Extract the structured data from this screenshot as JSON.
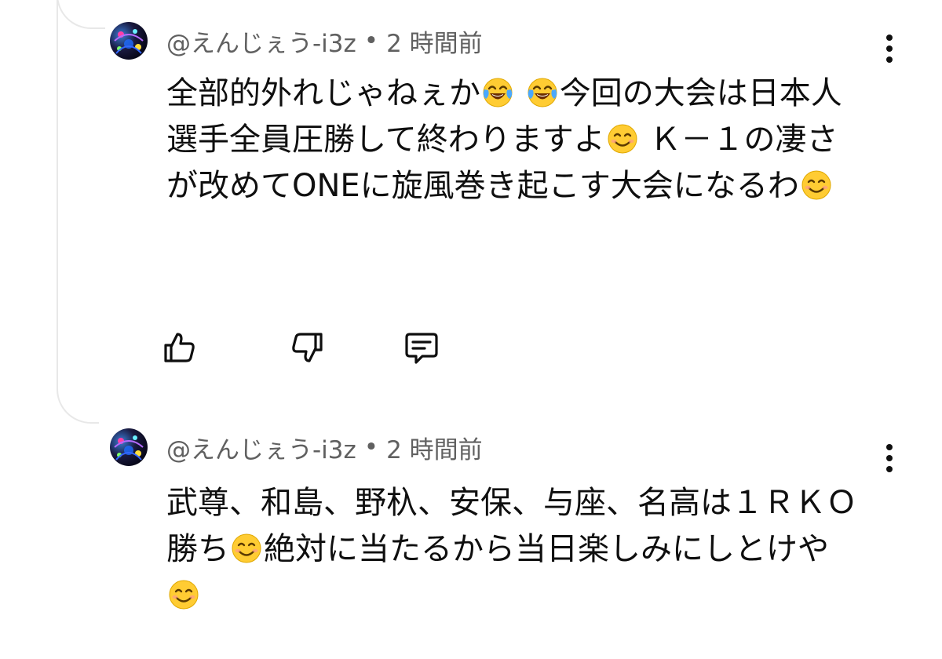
{
  "comments": [
    {
      "author": "@えんじぇう-i3z",
      "separator": "•",
      "time": "2 時間前",
      "segments": [
        {
          "text": "全部的外れじゃねぇか"
        },
        {
          "emoji": "face-with-tears-of-joy"
        },
        {
          "text": " "
        },
        {
          "emoji": "face-with-tears-of-joy"
        },
        {
          "text": "今回の大会は日本人選手全員圧勝して終わりますよ"
        },
        {
          "emoji": "smiling-face-with-smiling-eyes"
        },
        {
          "text": " Ｋ－１の凄さが改めてONEに旋風巻き起こす大会になるわ"
        },
        {
          "emoji": "smiling-face-with-smiling-eyes"
        }
      ],
      "actions": [
        {
          "name": "like-button",
          "icon": "thumbs-up-icon"
        },
        {
          "name": "dislike-button",
          "icon": "thumbs-down-icon"
        },
        {
          "name": "reply-button",
          "icon": "comment-icon"
        }
      ]
    },
    {
      "author": "@えんじぇう-i3z",
      "separator": "•",
      "time": "2 時間前",
      "segments": [
        {
          "text": "武尊、和島、野杁、安保、与座、名高は１ＲＫＯ勝ち"
        },
        {
          "emoji": "smiling-face-with-smiling-eyes"
        },
        {
          "text": "絶対に当たるから当日楽しみにしとけや"
        },
        {
          "emoji": "smiling-face-with-smiling-eyes"
        }
      ]
    }
  ],
  "colors": {
    "text": "#0f0f0f",
    "meta": "#606060",
    "thread": "#e8e8e8",
    "emoji_face": "#ffcc33",
    "emoji_tear": "#4aa8ff"
  }
}
